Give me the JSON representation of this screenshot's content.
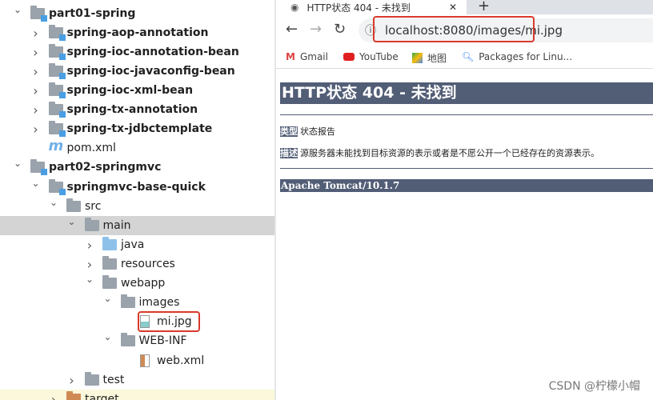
{
  "tree": {
    "items": [
      {
        "label": "part01-spring",
        "level": 1,
        "expanded": true,
        "icon": "module-folder",
        "bold": true
      },
      {
        "label": "spring-aop-annotation",
        "level": 2,
        "expanded": false,
        "icon": "module-folder",
        "bold": true
      },
      {
        "label": "spring-ioc-annotation-bean",
        "level": 2,
        "expanded": false,
        "icon": "module-folder",
        "bold": true
      },
      {
        "label": "spring-ioc-javaconfig-bean",
        "level": 2,
        "expanded": false,
        "icon": "module-folder",
        "bold": true
      },
      {
        "label": "spring-ioc-xml-bean",
        "level": 2,
        "expanded": false,
        "icon": "module-folder",
        "bold": true
      },
      {
        "label": "spring-tx-annotation",
        "level": 2,
        "expanded": false,
        "icon": "module-folder",
        "bold": true
      },
      {
        "label": "spring-tx-jdbctemplate",
        "level": 2,
        "expanded": false,
        "icon": "module-folder",
        "bold": true
      },
      {
        "label": "pom.xml",
        "level": 2,
        "icon": "maven-file"
      },
      {
        "label": "part02-springmvc",
        "level": 1,
        "expanded": true,
        "icon": "module-folder",
        "bold": true
      },
      {
        "label": "springmvc-base-quick",
        "level": 2,
        "expanded": true,
        "icon": "module-folder",
        "bold": true
      },
      {
        "label": "src",
        "level": 3,
        "expanded": true,
        "icon": "folder"
      },
      {
        "label": "main",
        "level": 4,
        "expanded": true,
        "icon": "folder",
        "selected": true
      },
      {
        "label": "java",
        "level": 5,
        "expanded": false,
        "icon": "source-folder"
      },
      {
        "label": "resources",
        "level": 5,
        "expanded": false,
        "icon": "resources-folder"
      },
      {
        "label": "webapp",
        "level": 5,
        "expanded": true,
        "icon": "web-folder"
      },
      {
        "label": "images",
        "level": 6,
        "expanded": true,
        "icon": "folder"
      },
      {
        "label": "mi.jpg",
        "level": 7,
        "icon": "image-file",
        "highlighted": true
      },
      {
        "label": "WEB-INF",
        "level": 6,
        "expanded": true,
        "icon": "folder"
      },
      {
        "label": "web.xml",
        "level": 7,
        "icon": "xml-file"
      },
      {
        "label": "test",
        "level": 4,
        "expanded": false,
        "icon": "folder"
      },
      {
        "label": "target",
        "level": 3,
        "expanded": false,
        "icon": "excluded-folder"
      }
    ]
  },
  "browser": {
    "tab_title": "HTTP状态 404 - 未找到",
    "url": "localhost:8080/images/mi.jpg",
    "bookmarks": [
      "Gmail",
      "YouTube",
      "地图",
      "Packages for Linu..."
    ],
    "page": {
      "heading": "HTTP状态 404 - 未找到",
      "type_label": "类型",
      "type_value": "状态报告",
      "desc_label": "描述",
      "desc_value": "源服务器未能找到目标资源的表示或者是不愿公开一个已经存在的资源表示。",
      "footer": "Apache Tomcat/10.1.7"
    }
  },
  "watermark": "CSDN @柠檬小帽",
  "colors": {
    "tomcat_band": "#525d76",
    "highlight": "#d9392b",
    "selected_row": "#d4d4d4"
  }
}
